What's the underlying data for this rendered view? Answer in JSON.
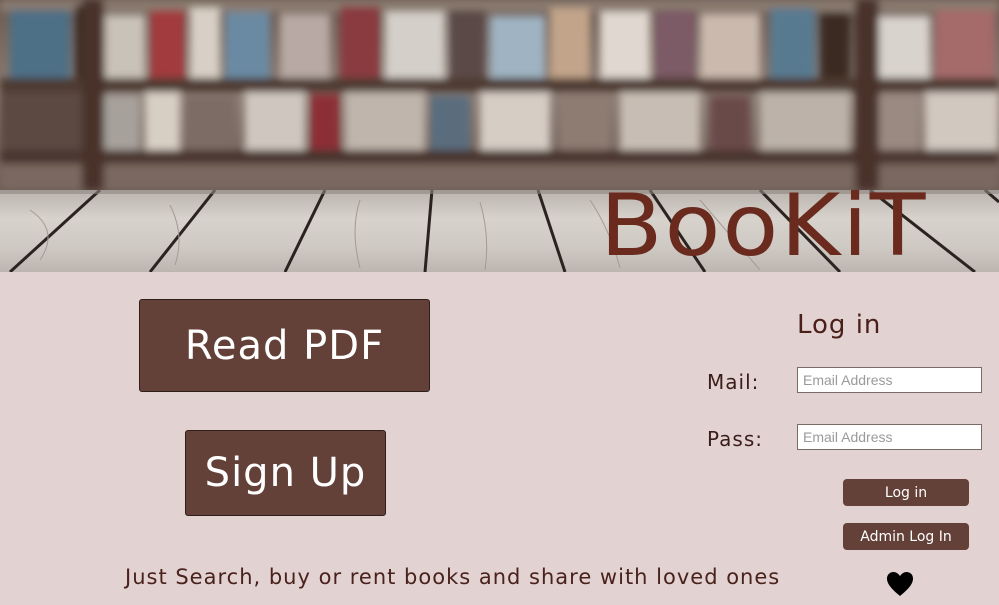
{
  "header": {
    "brand": "BooKiT"
  },
  "main": {
    "read_pdf_label": "Read PDF",
    "sign_up_label": "Sign Up"
  },
  "login": {
    "title": "Log in",
    "mail_label": "Mail:",
    "mail_placeholder": "Email Address",
    "pass_label": "Pass:",
    "pass_placeholder": "Email Address",
    "login_button": "Log in",
    "admin_login_button": "Admin Log In"
  },
  "footer": {
    "tagline": "Just Search, buy or rent books and share with loved ones",
    "icon": "heart-icon"
  },
  "colors": {
    "background": "#e2d2d2",
    "button": "#634038",
    "brand": "#6a2a1e"
  }
}
